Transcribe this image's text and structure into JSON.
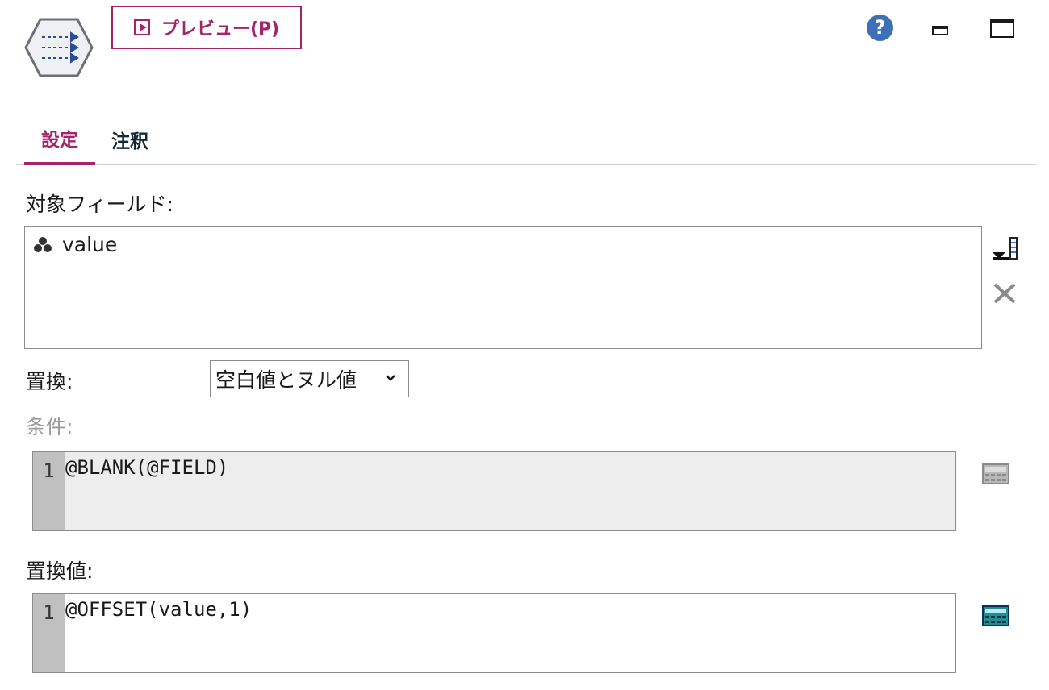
{
  "header": {
    "preview_label": "プレビュー(P)",
    "help_glyph": "?"
  },
  "tabs": [
    {
      "label": "設定",
      "active": true
    },
    {
      "label": "注釈",
      "active": false
    }
  ],
  "fields": {
    "label": "対象フィールド:",
    "items": [
      {
        "name": "value",
        "type_icon": "set-type-icon"
      }
    ]
  },
  "replace": {
    "label": "置換:",
    "selected": "空白値とヌル値"
  },
  "condition": {
    "label": "条件:",
    "enabled": false,
    "line_number": "1",
    "code": "@BLANK(@FIELD)"
  },
  "replace_value": {
    "label": "置換値:",
    "line_number": "1",
    "code": "@OFFSET(value,1)"
  },
  "colors": {
    "accent": "#a3246a",
    "help": "#3f6fb6",
    "disabled_text": "#9a9a9a",
    "gutter": "#c0c0c0"
  }
}
